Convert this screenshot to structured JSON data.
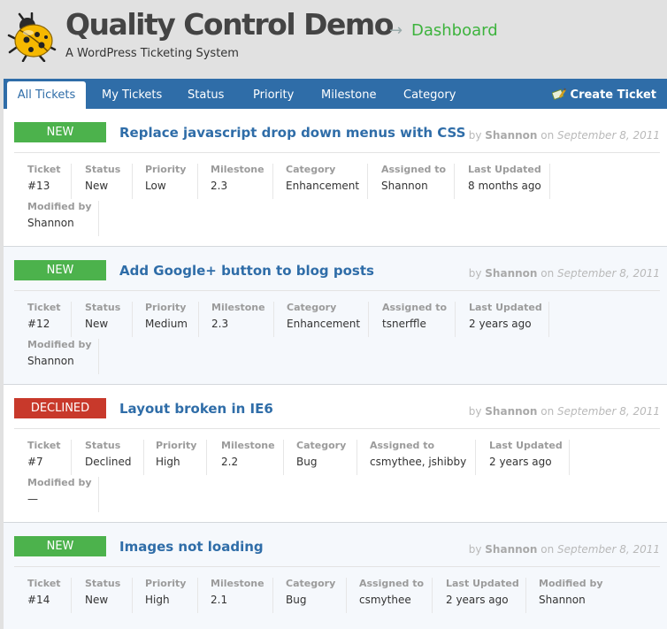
{
  "site": {
    "title": "Quality Control Demo",
    "arrow": "→",
    "dashboard": "Dashboard",
    "tagline": "A WordPress Ticketing System",
    "logo_icon": "ladybug-icon"
  },
  "nav": {
    "tabs": [
      "All Tickets",
      "My Tickets",
      "Status",
      "Priority",
      "Milestone",
      "Category"
    ],
    "create_label": "Create Ticket",
    "create_icon": "ticket-pencil-icon",
    "color": "#2f6da8"
  },
  "labels": {
    "ticket": "Ticket",
    "status": "Status",
    "priority": "Priority",
    "milestone": "Milestone",
    "category": "Category",
    "assigned": "Assigned to",
    "updated": "Last Updated",
    "modified": "Modified by"
  },
  "byline": {
    "by": "by",
    "on": "on"
  },
  "tickets": [
    {
      "badge": "NEW",
      "badge_color": "#4cb24c",
      "title": "Replace javascript drop down menus with CSS",
      "author": "Shannon",
      "date": "September 8, 2011",
      "ticket": "#13",
      "status": "New",
      "priority": "Low",
      "milestone": "2.3",
      "category": "Enhancement",
      "assigned": "Shannon",
      "updated": "8 months ago",
      "modified": "Shannon"
    },
    {
      "badge": "NEW",
      "badge_color": "#4cb24c",
      "title": "Add Google+ button to blog posts",
      "author": "Shannon",
      "date": "September 8, 2011",
      "ticket": "#12",
      "status": "New",
      "priority": "Medium",
      "milestone": "2.3",
      "category": "Enhancement",
      "assigned": "tsnerffle",
      "updated": "2 years ago",
      "modified": "Shannon"
    },
    {
      "badge": "DECLINED",
      "badge_color": "#c8392b",
      "title": "Layout broken in IE6",
      "author": "Shannon",
      "date": "September 8, 2011",
      "ticket": "#7",
      "status": "Declined",
      "priority": "High",
      "milestone": "2.2",
      "category": "Bug",
      "assigned": "csmythee, jshibby",
      "updated": "2 years ago",
      "modified": "—"
    },
    {
      "badge": "NEW",
      "badge_color": "#4cb24c",
      "title": "Images not loading",
      "author": "Shannon",
      "date": "September 8, 2011",
      "ticket": "#14",
      "status": "New",
      "priority": "High",
      "milestone": "2.1",
      "category": "Bug",
      "assigned": "csmythee",
      "updated": "2 years ago",
      "modified": "Shannon"
    }
  ]
}
